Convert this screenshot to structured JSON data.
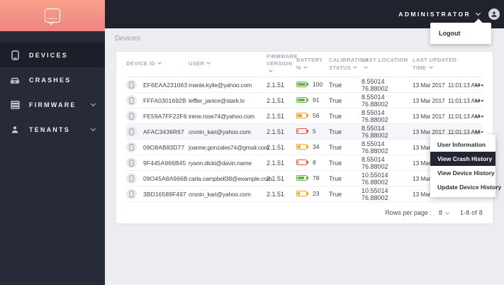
{
  "topbar": {
    "user_menu_label": "ADMINISTRATOR",
    "dropdown_items": [
      "Logout"
    ]
  },
  "sidebar": {
    "items": [
      {
        "label": "DEVICES",
        "icon": "smartphone-icon",
        "active": true,
        "has_submenu": false
      },
      {
        "label": "CRASHES",
        "icon": "car-icon",
        "active": false,
        "has_submenu": false
      },
      {
        "label": "FIRMWARE",
        "icon": "layers-icon",
        "active": false,
        "has_submenu": true
      },
      {
        "label": "TENANTS",
        "icon": "person-icon",
        "active": false,
        "has_submenu": true
      }
    ]
  },
  "breadcrumb": "Devices",
  "table": {
    "columns": [
      "DEVICE ID",
      "USER",
      "FIRMWARE VERSION",
      "BATTERY %",
      "CALIBRATION STATUS",
      "LAST LOCATION",
      "LAST UPDATED TIME"
    ],
    "rows": [
      {
        "id": "EF6EAA231063",
        "user": "mante.kylie@yahoo.com",
        "firmware": "2.1.51",
        "battery": 100,
        "battery_color": "green",
        "calibration": "True",
        "location": "8.55014 76.88002",
        "updated": "13 Mar 2017  11:01:13 AM"
      },
      {
        "id": "FFFA0301692B",
        "user": "leffler_janice@stark.tv",
        "firmware": "2.1.51",
        "battery": 91,
        "battery_color": "green",
        "calibration": "True",
        "location": "8.55014 76.88002",
        "updated": "13 Mar 2017  11:01:13 AM"
      },
      {
        "id": "FE59A7FF22F6",
        "user": "irene.rose74@yahoo.com",
        "firmware": "2.1.51",
        "battery": 56,
        "battery_color": "orange",
        "calibration": "True",
        "location": "8.55014 76.88002",
        "updated": "13 Mar 2017  11:01:13 AM"
      },
      {
        "id": "AFAC3436R67",
        "user": "cronin_kari@yahoo.com",
        "firmware": "2.1.51",
        "battery": 5,
        "battery_color": "red",
        "calibration": "True",
        "location": "8.55014 76.88002",
        "updated": "13 Mar 2017  11:01:13 AM"
      },
      {
        "id": "09O8AB83D77",
        "user": "joanne.gonzales74@gmail.com",
        "firmware": "2.1.51",
        "battery": 34,
        "battery_color": "orange",
        "calibration": "True",
        "location": "8.55014 76.88002",
        "updated": "13 Mar 2017  11:01:13 AM"
      },
      {
        "id": "9F445A966B45",
        "user": "ryann.dicki@davin.name",
        "firmware": "2.1.51",
        "battery": 8,
        "battery_color": "red",
        "calibration": "True",
        "location": "8.55014 76.88002",
        "updated": "13 Mar 2017  11:01:13 AM"
      },
      {
        "id": "09O45A8A966B",
        "user": "carla.campbell38@example.com",
        "firmware": "2.1.51",
        "battery": 78,
        "battery_color": "green",
        "calibration": "True",
        "location": "10.55014 76.88002",
        "updated": "13 Mar 2017  11:01:13 AM"
      },
      {
        "id": "3BD16589F497",
        "user": "cronin_kari@yahoo.com",
        "firmware": "2.1.51",
        "battery": 23,
        "battery_color": "orange",
        "calibration": "True",
        "location": "10.55014 76.88002",
        "updated": "13 Mar 2017  11:01:13 AM"
      }
    ]
  },
  "context_menu": {
    "items": [
      "User Information",
      "View Crash History",
      "View Device History",
      "Update Device History"
    ],
    "highlighted": "View Crash History"
  },
  "pagination": {
    "rows_per_page_label": "Rows per page :",
    "rows_per_page": "8",
    "range": "1-8 of 8"
  },
  "colors": {
    "accent_gradient_start": "#f8a18a",
    "accent_gradient_end": "#ee8483",
    "sidebar_bg": "#272a39",
    "sidebar_active_bg": "#1c1e29",
    "topbar_bg": "#20222e",
    "content_bg": "#ecedf0",
    "menu_highlight": "#232532",
    "battery_green": "#6ab04c",
    "battery_orange": "#f0a132",
    "battery_red": "#e2574c"
  }
}
